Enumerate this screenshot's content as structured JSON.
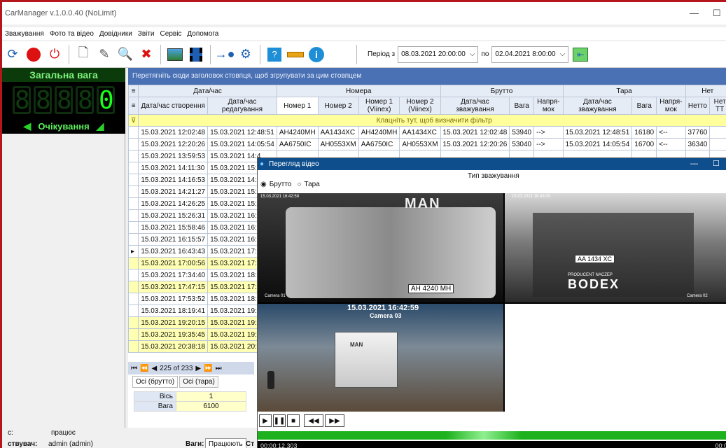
{
  "app": {
    "title": "CarManager v.1.0.0.40 (NoLimit)",
    "minimize": "—",
    "maximize": "☐"
  },
  "menu": [
    "Зважування",
    "Фото та відео",
    "Довідники",
    "Звіти",
    "Сервіс",
    "Допомога"
  ],
  "toolbar": {
    "period_from_label": "Період з",
    "period_from": "08.03.2021 20:00:00",
    "period_to_label": "по",
    "period_to": "02.04.2021 8:00:00"
  },
  "scale": {
    "title": "Загальна вага",
    "digits": [
      "8",
      "8",
      "8",
      "8",
      "0"
    ],
    "status": "Очікування"
  },
  "grid": {
    "group_hint": "Перетягніть сюди заголовок стовпця, щоб згрупувати за цим стовпцем",
    "band_headers": [
      "Дата/час",
      "Номера",
      "Брутто",
      "Тара",
      "Нет"
    ],
    "columns": [
      "Дата/час створення",
      "Дата/час редагування",
      "Номер 1",
      "Номер 2",
      "Номер 1 (Viinex)",
      "Номер 2 (Viinex)",
      "Дата/час зважування",
      "Вага",
      "Напря-мок",
      "Дата/час зважування",
      "Вага",
      "Напря-мок",
      "Нетто",
      "Нет ТТ"
    ],
    "filter_hint": "Клацніть тут, щоб визначити фільтр",
    "rows": [
      {
        "c": "15.03.2021 12:02:48",
        "e": "15.03.2021 12:48:51",
        "n1": "AH4240MH",
        "n2": "AA1434XC",
        "v1": "AH4240MH",
        "v2": "AA1434XC",
        "bd": "15.03.2021 12:02:48",
        "bw": "53940",
        "bdir": "-->",
        "td": "15.03.2021 12:48:51",
        "tw": "16180",
        "tdir": "<--",
        "net": "37760",
        "y": false,
        "cur": false
      },
      {
        "c": "15.03.2021 12:20:26",
        "e": "15.03.2021 14:05:54",
        "n1": "AA6750IC",
        "n2": "AH0553XM",
        "v1": "AA6750IC",
        "v2": "AH0553XM",
        "bd": "15.03.2021 12:20:26",
        "bw": "53040",
        "bdir": "-->",
        "td": "15.03.2021 14:05:54",
        "tw": "16700",
        "tdir": "<--",
        "net": "36340",
        "y": false,
        "cur": false
      },
      {
        "c": "15.03.2021 13:59:53",
        "e": "15.03.2021 14:4",
        "y": false,
        "cur": false
      },
      {
        "c": "15.03.2021 14:11:30",
        "e": "15.03.2021 15:0",
        "y": false,
        "cur": false
      },
      {
        "c": "15.03.2021 14:16:53",
        "e": "15.03.2021 14:5",
        "y": false,
        "cur": false
      },
      {
        "c": "15.03.2021 14:21:27",
        "e": "15.03.2021 15:1",
        "y": false,
        "cur": false
      },
      {
        "c": "15.03.2021 14:26:25",
        "e": "15.03.2021 15:2",
        "y": false,
        "cur": false
      },
      {
        "c": "15.03.2021 15:26:31",
        "e": "15.03.2021 16:0",
        "y": false,
        "cur": false
      },
      {
        "c": "15.03.2021 15:58:46",
        "e": "15.03.2021 16:3",
        "y": false,
        "cur": false
      },
      {
        "c": "15.03.2021 16:15:57",
        "e": "15.03.2021 16:5",
        "y": false,
        "cur": false
      },
      {
        "c": "15.03.2021 16:43:43",
        "e": "15.03.2021 17:2",
        "y": false,
        "cur": true
      },
      {
        "c": "15.03.2021 17:00:56",
        "e": "15.03.2021 17:0",
        "y": true,
        "cur": false
      },
      {
        "c": "15.03.2021 17:34:40",
        "e": "15.03.2021 18:2",
        "y": false,
        "cur": false
      },
      {
        "c": "15.03.2021 17:47:15",
        "e": "15.03.2021 17:4",
        "y": true,
        "cur": false
      },
      {
        "c": "15.03.2021 17:53:52",
        "e": "15.03.2021 18:3",
        "y": false,
        "cur": false
      },
      {
        "c": "15.03.2021 18:19:41",
        "e": "15.03.2021 19:0",
        "y": false,
        "cur": false
      },
      {
        "c": "15.03.2021 19:20:15",
        "e": "15.03.2021 19:2",
        "y": true,
        "cur": false
      },
      {
        "c": "15.03.2021 19:35:45",
        "e": "15.03.2021 19:3",
        "y": true,
        "cur": false
      },
      {
        "c": "15.03.2021 20:38:18",
        "e": "15.03.2021 20:3",
        "y": true,
        "cur": false
      }
    ],
    "pager": "225 of 233"
  },
  "axles": {
    "tabs": [
      "Осі (брутто)",
      "Осі (тара)"
    ],
    "axle_label": "Вісь",
    "axle_value": "1",
    "weight_label": "Вага",
    "weight_value": "6100"
  },
  "bottom": {
    "status_left": "працює",
    "user_label": "ствувач:",
    "user_value": "admin (admin)",
    "scales_label": "Ваги:",
    "scales_value": "Працюють",
    "c_label": "Ст",
    "left_c": "с:"
  },
  "video": {
    "title": "Перегляд відео",
    "weigh_type_label": "Тип зважування",
    "radio_gross": "Брутто",
    "radio_tare": "Тара",
    "cam1": {
      "ts": "15.03.2021 16:42:58",
      "label": "Camera 01",
      "brand": "MAN",
      "plate": "AH 4240 MH"
    },
    "cam2": {
      "ts": "15.03.2021 16:43:00",
      "label": "Camera 02",
      "plate": "AA 1434 XC",
      "brand": "BODEX",
      "sub": "PRODUCENT NACZEP"
    },
    "cam3": {
      "ts": "15.03.2021 16:42:59",
      "label": "Camera 03",
      "brand": "MAN"
    },
    "time_current": "00:00:12.303",
    "time_end": "00:0"
  }
}
